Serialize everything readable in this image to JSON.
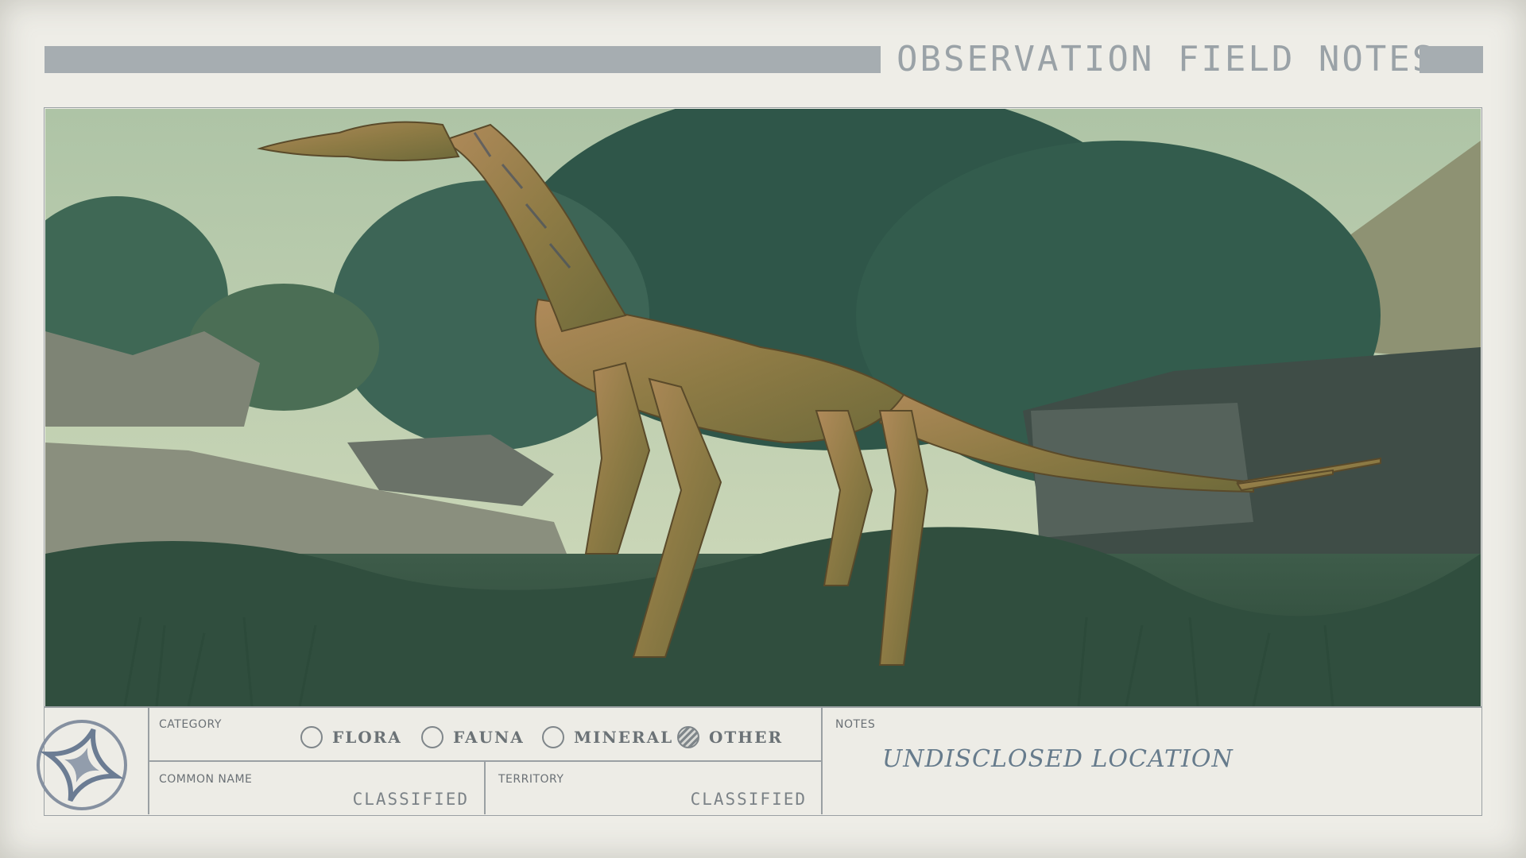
{
  "header": {
    "title": "OBSERVATION FIELD NOTES"
  },
  "photo": {
    "subject_icon": "alien-creature-photo"
  },
  "form": {
    "category": {
      "label": "CATEGORY",
      "options": [
        {
          "label": "FLORA",
          "selected": false
        },
        {
          "label": "FAUNA",
          "selected": false
        },
        {
          "label": "MINERAL",
          "selected": false
        },
        {
          "label": "OTHER",
          "selected": true
        }
      ]
    },
    "common_name": {
      "label": "COMMON NAME",
      "value": "CLASSIFIED"
    },
    "territory": {
      "label": "TERRITORY",
      "value": "CLASSIFIED"
    },
    "notes": {
      "label": "NOTES",
      "value": "UNDISCLOSED LOCATION"
    }
  },
  "colors": {
    "paper": "#eeede7",
    "ink": "#6b7276",
    "bar": "#a6adb1",
    "handwriting": "#667b8c"
  }
}
